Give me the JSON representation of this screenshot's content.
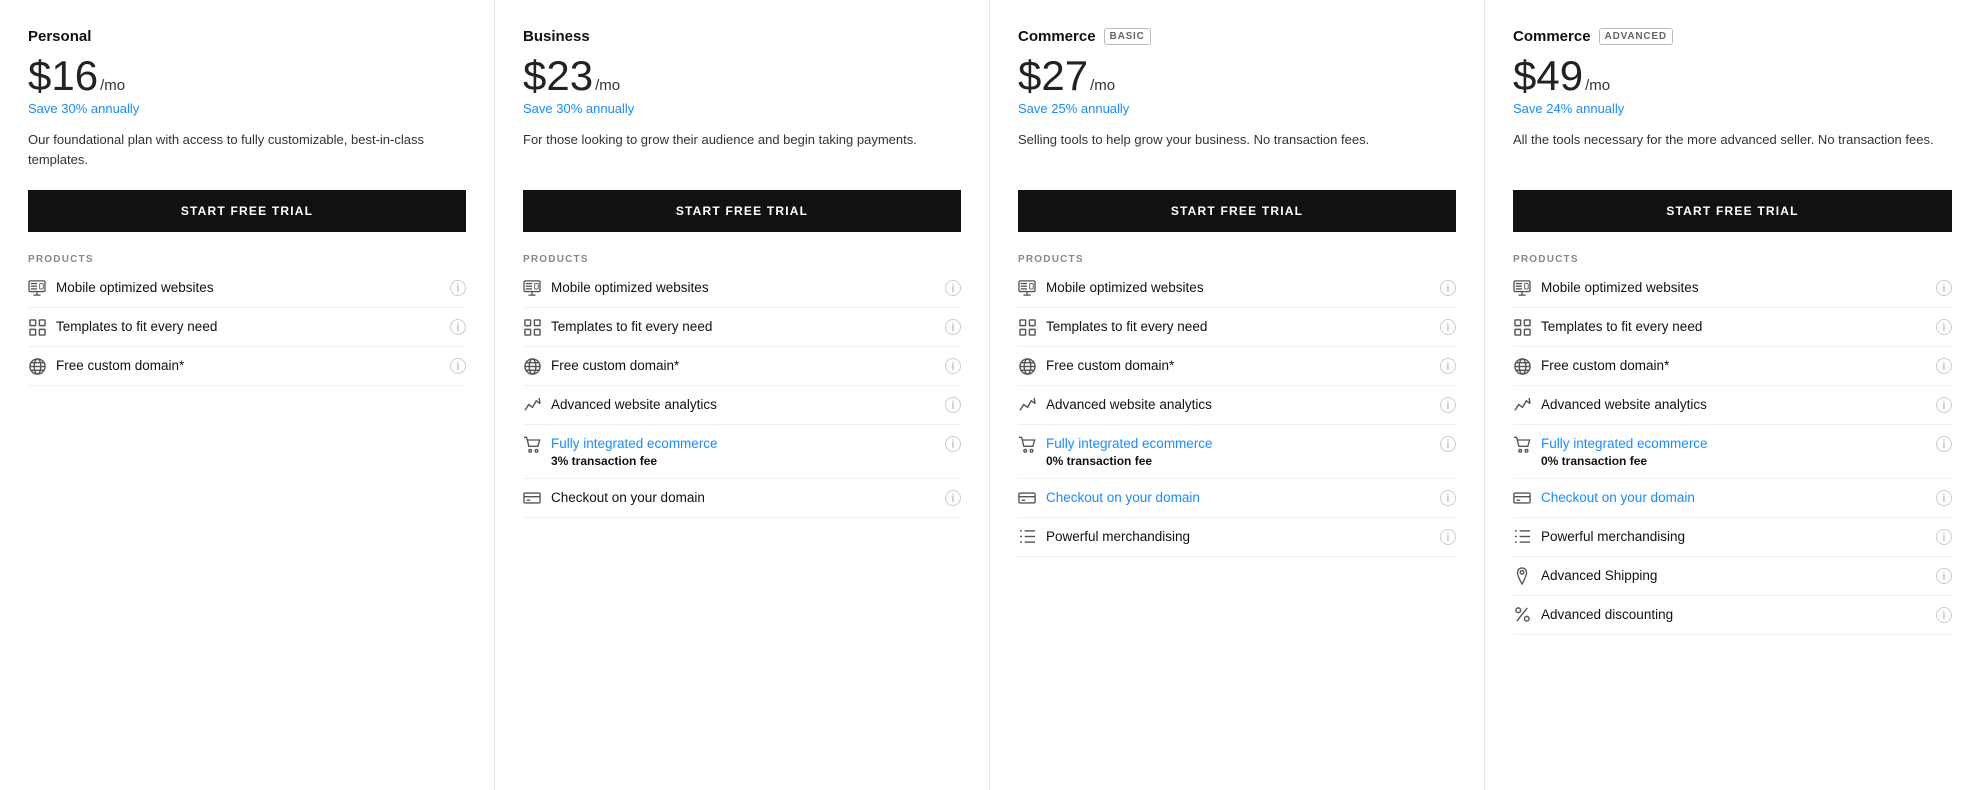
{
  "plans": [
    {
      "id": "personal",
      "name": "Personal",
      "badge": null,
      "price": "$16",
      "period": "/mo",
      "save": "Save 30% annually",
      "description": "Our foundational plan with access to fully customizable, best-in-class templates.",
      "cta": "START FREE TRIAL",
      "sectionLabel": "PRODUCTS",
      "features": [
        {
          "icon": "monitor-icon",
          "text": "Mobile optimized websites",
          "subtext": null,
          "linked": false
        },
        {
          "icon": "grid-icon",
          "text": "Templates to fit every need",
          "subtext": null,
          "linked": false
        },
        {
          "icon": "globe-icon",
          "text": "Free custom domain*",
          "subtext": null,
          "linked": false
        }
      ]
    },
    {
      "id": "business",
      "name": "Business",
      "badge": null,
      "price": "$23",
      "period": "/mo",
      "save": "Save 30% annually",
      "description": "For those looking to grow their audience and begin taking payments.",
      "cta": "START FREE TRIAL",
      "sectionLabel": "PRODUCTS",
      "features": [
        {
          "icon": "monitor-icon",
          "text": "Mobile optimized websites",
          "subtext": null,
          "linked": false
        },
        {
          "icon": "grid-icon",
          "text": "Templates to fit every need",
          "subtext": null,
          "linked": false
        },
        {
          "icon": "globe-icon",
          "text": "Free custom domain*",
          "subtext": null,
          "linked": false
        },
        {
          "icon": "analytics-icon",
          "text": "Advanced website analytics",
          "subtext": null,
          "linked": false
        },
        {
          "icon": "cart-icon",
          "text": "Fully integrated ecommerce",
          "subtext": "3% transaction fee",
          "linked": true
        },
        {
          "icon": "card-icon",
          "text": "Checkout on your domain",
          "subtext": null,
          "linked": false
        }
      ]
    },
    {
      "id": "commerce-basic",
      "name": "Commerce",
      "badge": "BASIC",
      "price": "$27",
      "period": "/mo",
      "save": "Save 25% annually",
      "description": "Selling tools to help grow your business. No transaction fees.",
      "cta": "START FREE TRIAL",
      "sectionLabel": "PRODUCTS",
      "features": [
        {
          "icon": "monitor-icon",
          "text": "Mobile optimized websites",
          "subtext": null,
          "linked": false
        },
        {
          "icon": "grid-icon",
          "text": "Templates to fit every need",
          "subtext": null,
          "linked": false
        },
        {
          "icon": "globe-icon",
          "text": "Free custom domain*",
          "subtext": null,
          "linked": false
        },
        {
          "icon": "analytics-icon",
          "text": "Advanced website analytics",
          "subtext": null,
          "linked": false
        },
        {
          "icon": "cart-icon",
          "text": "Fully integrated ecommerce",
          "subtext": "0% transaction fee",
          "linked": true
        },
        {
          "icon": "card-icon",
          "text": "Checkout on your domain",
          "subtext": null,
          "linked": true
        },
        {
          "icon": "list-icon",
          "text": "Powerful merchandising",
          "subtext": null,
          "linked": false
        }
      ]
    },
    {
      "id": "commerce-advanced",
      "name": "Commerce",
      "badge": "ADVANCED",
      "price": "$49",
      "period": "/mo",
      "save": "Save 24% annually",
      "description": "All the tools necessary for the more advanced seller. No transaction fees.",
      "cta": "START FREE TRIAL",
      "sectionLabel": "PRODUCTS",
      "features": [
        {
          "icon": "monitor-icon",
          "text": "Mobile optimized websites",
          "subtext": null,
          "linked": false
        },
        {
          "icon": "grid-icon",
          "text": "Templates to fit every need",
          "subtext": null,
          "linked": false
        },
        {
          "icon": "globe-icon",
          "text": "Free custom domain*",
          "subtext": null,
          "linked": false
        },
        {
          "icon": "analytics-icon",
          "text": "Advanced website analytics",
          "subtext": null,
          "linked": false
        },
        {
          "icon": "cart-icon",
          "text": "Fully integrated ecommerce",
          "subtext": "0% transaction fee",
          "linked": true
        },
        {
          "icon": "card-icon",
          "text": "Checkout on your domain",
          "subtext": null,
          "linked": true
        },
        {
          "icon": "list-icon",
          "text": "Powerful merchandising",
          "subtext": null,
          "linked": false
        },
        {
          "icon": "pin-icon",
          "text": "Advanced Shipping",
          "subtext": null,
          "linked": false
        },
        {
          "icon": "percent-icon",
          "text": "Advanced discounting",
          "subtext": null,
          "linked": false
        }
      ]
    }
  ],
  "icons": {
    "monitor-icon": "&#9707;",
    "grid-icon": "&#9783;",
    "globe-icon": "&#9898;",
    "analytics-icon": "&#9998;",
    "cart-icon": "&#9840;",
    "card-icon": "&#9646;",
    "list-icon": "&#9776;",
    "pin-icon": "&#9679;",
    "percent-icon": "%",
    "info-icon": "i"
  }
}
